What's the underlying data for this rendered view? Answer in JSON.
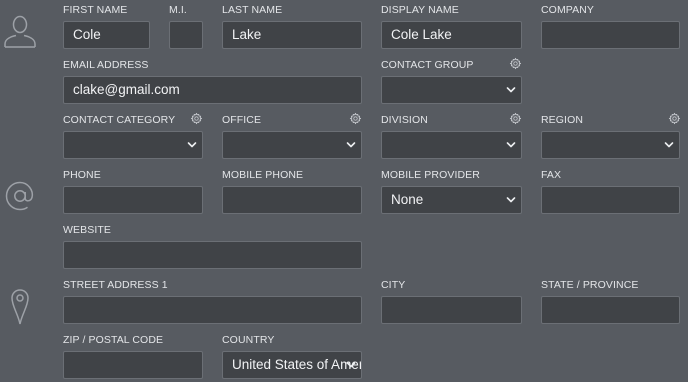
{
  "labels": {
    "first_name": "FIRST NAME",
    "mi": "M.I.",
    "last_name": "LAST NAME",
    "display_name": "DISPLAY NAME",
    "company": "COMPANY",
    "email": "EMAIL ADDRESS",
    "contact_group": "CONTACT GROUP",
    "contact_category": "CONTACT CATEGORY",
    "office": "OFFICE",
    "division": "DIVISION",
    "region": "REGION",
    "phone": "PHONE",
    "mobile_phone": "MOBILE PHONE",
    "mobile_provider": "MOBILE PROVIDER",
    "fax": "FAX",
    "website": "WEBSITE",
    "street1": "STREET ADDRESS 1",
    "city": "CITY",
    "state": "STATE / PROVINCE",
    "zip": "ZIP / POSTAL CODE",
    "country": "COUNTRY"
  },
  "values": {
    "first_name": "Cole",
    "mi": "",
    "last_name": "Lake",
    "display_name": "Cole Lake",
    "company": "",
    "email": "clake@gmail.com",
    "contact_group": "",
    "contact_category": "",
    "office": "",
    "division": "",
    "region": "",
    "phone": "",
    "mobile_phone": "",
    "mobile_provider": "None",
    "fax": "",
    "website": "",
    "street1": "",
    "city": "",
    "state": "",
    "zip": "",
    "country": "United States of America"
  },
  "icons": {
    "section_person": "person-icon",
    "section_contact": "at-sign-icon",
    "section_address": "map-pin-icon",
    "field_settings": "gear-icon",
    "dropdown": "chevron-down-icon"
  },
  "colors": {
    "background": "#575b61",
    "field": "#404347",
    "field_border": "#6b6f75",
    "text": "#f2f3f5",
    "label": "#e3e5e8",
    "icon": "#9da1a7"
  }
}
